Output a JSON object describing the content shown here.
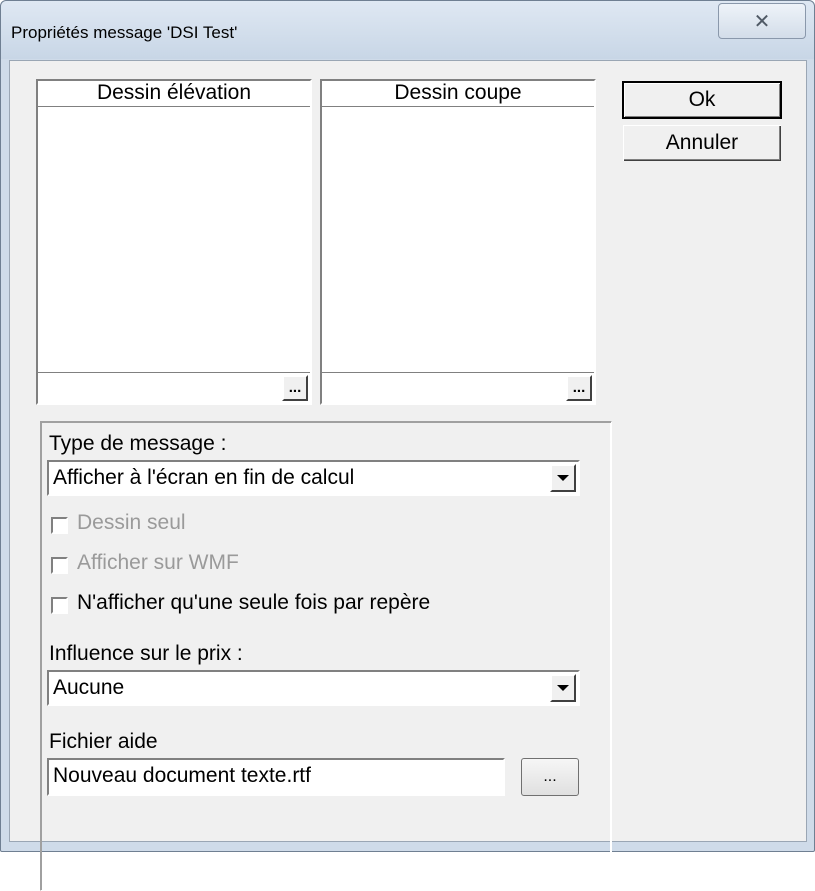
{
  "window": {
    "title": "Propriétés message 'DSI Test'",
    "close_glyph": "✕"
  },
  "drawings": {
    "elevation": {
      "header": "Dessin élévation",
      "browse_label": "..."
    },
    "section": {
      "header": "Dessin coupe",
      "browse_label": "..."
    }
  },
  "buttons": {
    "ok": "Ok",
    "cancel": "Annuler"
  },
  "message_type": {
    "label": "Type de message :",
    "selected": "Afficher à l'écran en fin de calcul"
  },
  "checkboxes": [
    {
      "label": "Dessin seul",
      "checked": false,
      "enabled": false
    },
    {
      "label": "Afficher sur WMF",
      "checked": false,
      "enabled": false
    },
    {
      "label": "N'afficher qu'une seule fois par repère",
      "checked": false,
      "enabled": true
    }
  ],
  "price_influence": {
    "label": "Influence sur le prix :",
    "selected": "Aucune"
  },
  "help_file": {
    "label": "Fichier aide",
    "value": "Nouveau document texte.rtf",
    "browse_label": "..."
  },
  "icons": {
    "close": "close-icon",
    "dropdown": "chevron-down-icon"
  }
}
